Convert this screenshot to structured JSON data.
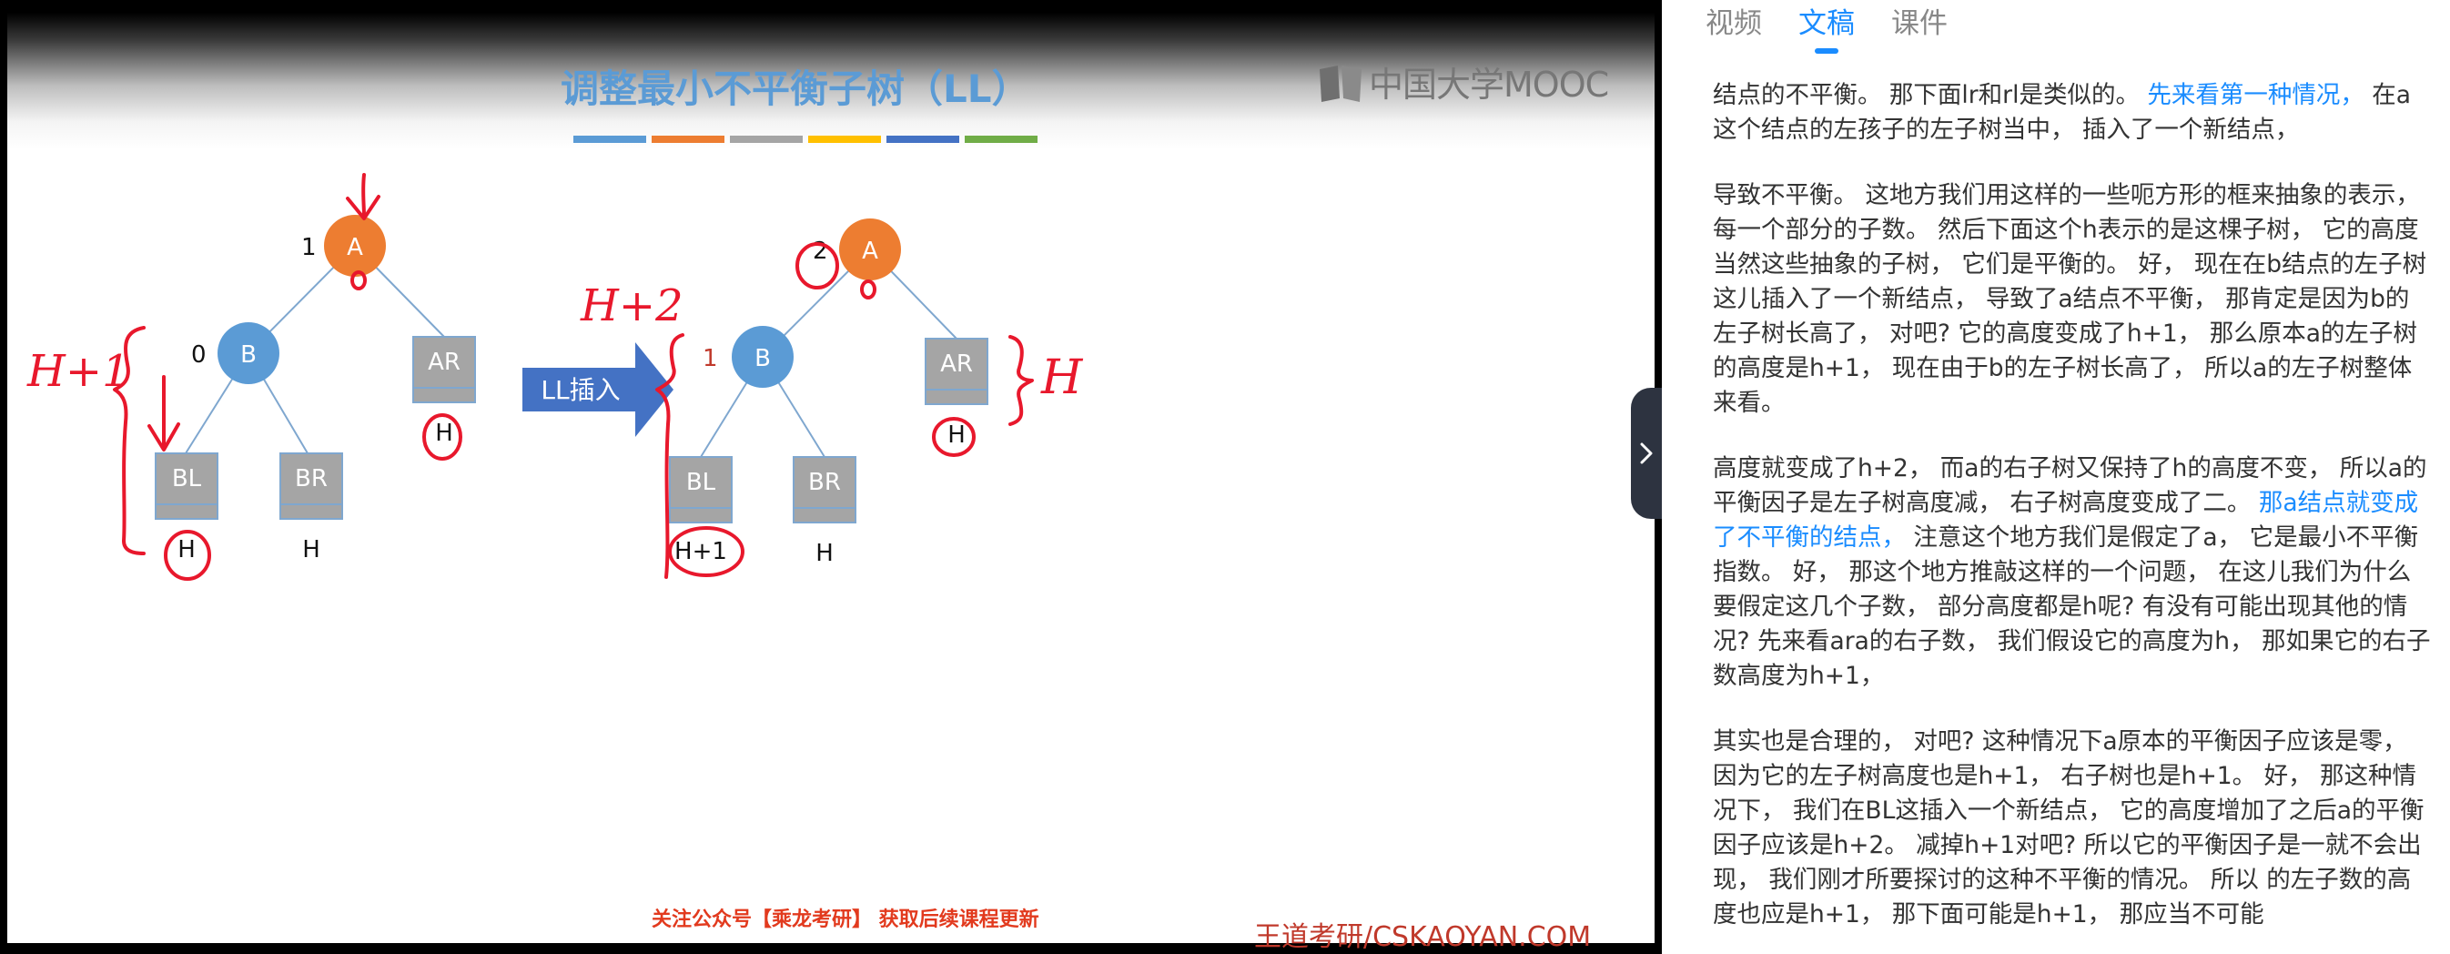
{
  "slide": {
    "title": "调整最小不平衡子树（LL）",
    "logo_text": "中国大学MOOC",
    "footer_note": "关注公众号【乘龙考研】 获取后续课程更新",
    "footer_brand": "王道考研/CSKAOYAN.COM",
    "title_bar_colors": [
      "#5b9bd5",
      "#ed7d31",
      "#a5a5a5",
      "#ffc000",
      "#4472c4",
      "#70ad47"
    ],
    "left_tree": {
      "root": "A",
      "root_factor": "1",
      "left": "B",
      "left_factor": "0",
      "right": "AR",
      "right_height": "H",
      "left_left": "BL",
      "left_left_height": "H",
      "left_right": "BR",
      "left_right_height": "H"
    },
    "arrow_label": "LL插入",
    "right_tree": {
      "root": "A",
      "root_factor": "2",
      "left": "B",
      "left_factor": "1",
      "right": "AR",
      "right_height": "H",
      "left_left": "BL",
      "left_left_height": "H+1",
      "left_right": "BR",
      "left_right_height": "H"
    },
    "handwriting": {
      "h_plus_1": "H+1",
      "h_plus_2": "H+2",
      "h": "H"
    }
  },
  "side_panel": {
    "tabs": [
      {
        "label": "视频",
        "active": false
      },
      {
        "label": "文稿",
        "active": true
      },
      {
        "label": "课件",
        "active": false
      }
    ],
    "accent_color": "#1a8cff",
    "paragraphs": [
      [
        {
          "t": "结点的不平衡。 那下面lr和rl是类似的。 ",
          "hl": false
        },
        {
          "t": "先来看第一种情况，",
          "hl": true
        },
        {
          "t": " 在a这个结点的左孩子的左子树当中， 插入了一个新结点，",
          "hl": false
        }
      ],
      [
        {
          "t": "导致不平衡。 这地方我们用这样的一些呃方形的框来抽象的表示， 每一个部分的子数。 然后下面这个h表示的是这棵子树， 它的高度当然这些抽象的子树， 它们是平衡的。 好， 现在在b结点的左子树这儿插入了一个新结点， 导致了a结点不平衡， 那肯定是因为b的左子树长高了， 对吧? 它的高度变成了h+1， 那么原本a的左子树的高度是h+1， 现在由于b的左子树长高了， 所以a的左子树整体来看。",
          "hl": false
        }
      ],
      [
        {
          "t": "高度就变成了h+2， 而a的右子树又保持了h的高度不变， 所以a的平衡因子是左子树高度减， 右子树高度变成了二。 ",
          "hl": false
        },
        {
          "t": "那a结点就变成了不平衡的结点，",
          "hl": true
        },
        {
          "t": " 注意这个地方我们是假定了a， 它是最小不平衡指数。 好， 那这个地方推敲这样的一个问题， 在这儿我们为什么要假定这几个子数， 部分高度都是h呢? 有没有可能出现其他的情况? 先来看ara的右子数， 我们假设它的高度为h， 那如果它的右子数高度为h+1，",
          "hl": false
        }
      ],
      [
        {
          "t": "其实也是合理的， 对吧? 这种情况下a原本的平衡因子应该是零， 因为它的左子树高度也是h+1， 右子树也是h+1。 好， 那这种情况下， 我们在BL这插入一个新结点， 它的高度增加了之后a的平衡因子应该是h+2。 减掉h+1对吧? 所以它的平衡因子是一就不会出现， 我们刚才所要探讨的这种不平衡的情况。 所以 的左子数的高度也应是h+1， 那下面可能是h+1， 那应当不可能",
          "hl": false
        }
      ]
    ]
  }
}
